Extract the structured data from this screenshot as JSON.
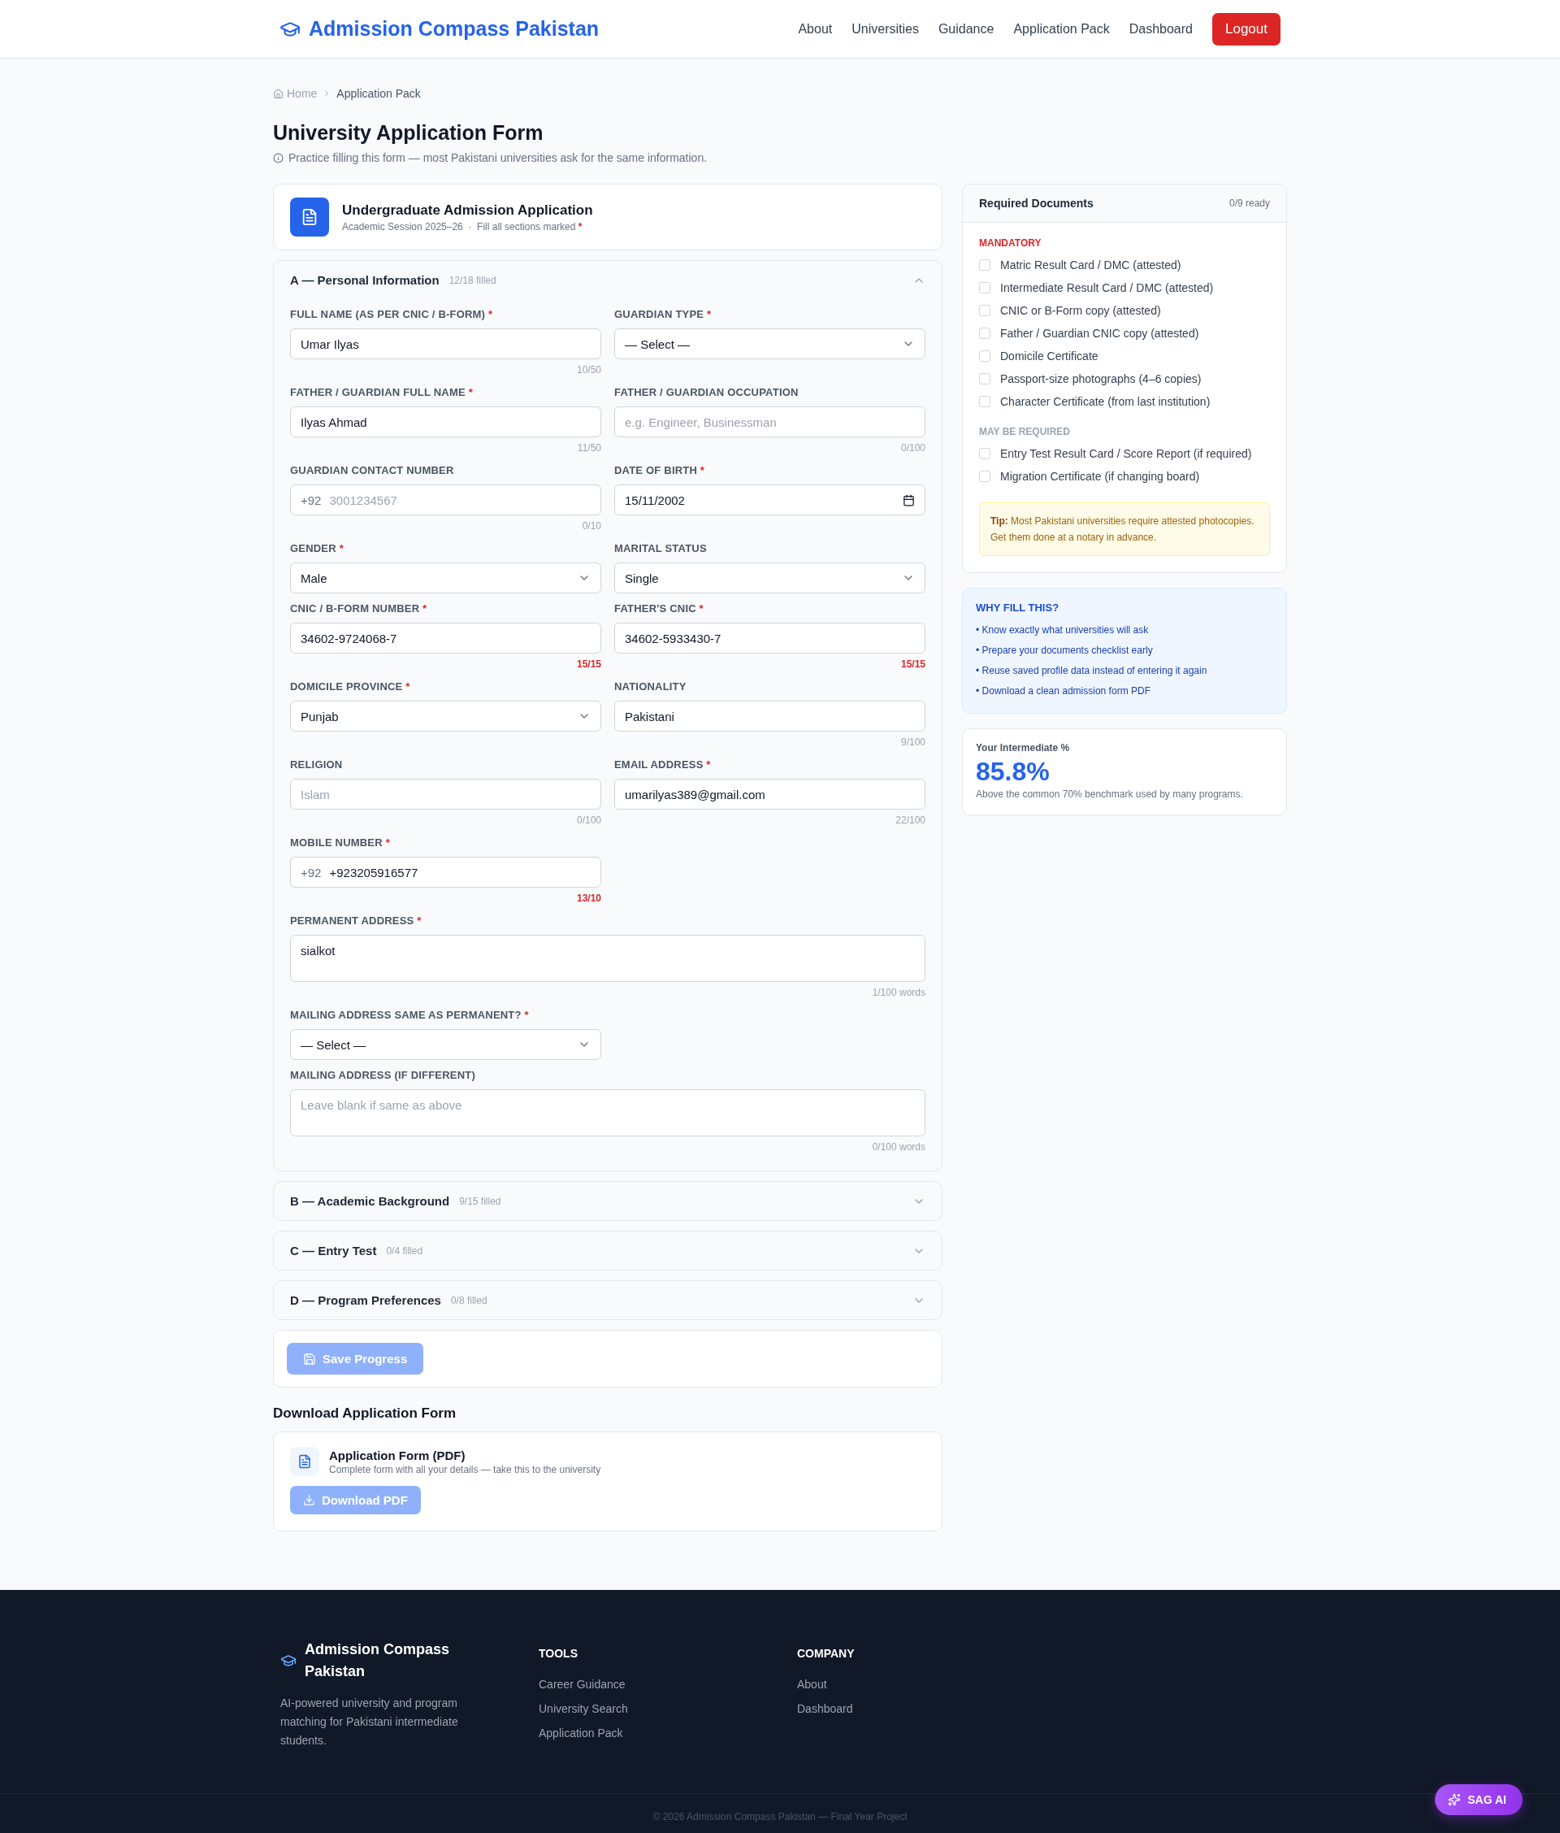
{
  "header": {
    "brand": "Admission Compass Pakistan",
    "nav": [
      {
        "label": "About"
      },
      {
        "label": "Universities"
      },
      {
        "label": "Guidance"
      },
      {
        "label": "Application Pack"
      },
      {
        "label": "Dashboard"
      }
    ],
    "logout": "Logout"
  },
  "breadcrumb": {
    "home": "Home",
    "current": "Application Pack"
  },
  "page": {
    "title": "University Application Form",
    "subtitle": "Practice filling this form — most Pakistani universities ask for the same information."
  },
  "form_header": {
    "title": "Undergraduate Admission Application",
    "subtitle": "Academic Session 2025–26  ·  Fill all sections marked",
    "required_mark": "*"
  },
  "sections": [
    {
      "label": "A — Personal Information",
      "progress": "12/18 filled",
      "expanded": true,
      "fields": [
        {
          "kind": "text",
          "label": "FULL NAME (AS PER CNIC / B-FORM)",
          "required_mark": "*",
          "value": "Umar Ilyas",
          "counter": "10/50",
          "over": false
        },
        {
          "kind": "select",
          "label": "GUARDIAN TYPE",
          "required_mark": "*",
          "value": "— Select —"
        },
        {
          "kind": "text",
          "label": "FATHER / GUARDIAN FULL NAME",
          "required_mark": "*",
          "value": "Ilyas Ahmad",
          "counter": "11/50",
          "over": false
        },
        {
          "kind": "text",
          "label": "FATHER / GUARDIAN OCCUPATION",
          "placeholder": "e.g. Engineer, Businessman",
          "counter": "0/100",
          "over": false
        },
        {
          "kind": "phone",
          "label": "GUARDIAN CONTACT NUMBER",
          "prefix": "+92",
          "placeholder": "3001234567",
          "counter": "0/10",
          "over": false
        },
        {
          "kind": "date",
          "label": "DATE OF BIRTH",
          "required_mark": "*",
          "value": "15/11/2002"
        },
        {
          "kind": "select",
          "label": "GENDER",
          "required_mark": "*",
          "value": "Male"
        },
        {
          "kind": "select",
          "label": "MARITAL STATUS",
          "value": "Single"
        },
        {
          "kind": "text",
          "label": "CNIC / B-FORM NUMBER",
          "required_mark": "*",
          "value": "34602-9724068-7",
          "counter": "15/15",
          "over": true
        },
        {
          "kind": "text",
          "label": "FATHER'S CNIC",
          "required_mark": "*",
          "value": "34602-5933430-7",
          "counter": "15/15",
          "over": true
        },
        {
          "kind": "select",
          "label": "DOMICILE PROVINCE",
          "required_mark": "*",
          "value": "Punjab"
        },
        {
          "kind": "text",
          "label": "NATIONALITY",
          "value": "Pakistani",
          "counter": "9/100",
          "over": false
        },
        {
          "kind": "text",
          "label": "RELIGION",
          "placeholder": "Islam",
          "counter": "0/100",
          "over": false
        },
        {
          "kind": "text",
          "label": "EMAIL ADDRESS",
          "required_mark": "*",
          "value": "umarilyas389@gmail.com",
          "counter": "22/100",
          "over": false
        },
        {
          "kind": "phone",
          "label": "MOBILE NUMBER",
          "required_mark": "*",
          "prefix": "+92",
          "value": "+923205916577",
          "counter": "13/10",
          "over": true
        },
        {
          "kind": "textarea",
          "label": "PERMANENT ADDRESS",
          "required_mark": "*",
          "value": "sialkot",
          "counter": "1/100 words",
          "over": false
        },
        {
          "kind": "select",
          "label": "MAILING ADDRESS SAME AS PERMANENT?",
          "required_mark": "*",
          "value": "— Select —"
        },
        {
          "kind": "textarea",
          "label": "MAILING ADDRESS (IF DIFFERENT)",
          "placeholder": "Leave blank if same as above",
          "counter": "0/100 words",
          "over": false
        }
      ]
    },
    {
      "label": "B — Academic Background",
      "progress": "9/15 filled",
      "expanded": false
    },
    {
      "label": "C — Entry Test",
      "progress": "0/4 filled",
      "expanded": false
    },
    {
      "label": "D — Program Preferences",
      "progress": "0/8 filled",
      "expanded": false
    }
  ],
  "save_button": {
    "label": "Save Progress",
    "disabled": true
  },
  "download": {
    "heading": "Download Application Form",
    "title": "Application Form (PDF)",
    "description": "Complete form with all your details — take this to the university",
    "button": {
      "label": "Download PDF",
      "disabled": true
    }
  },
  "documents": {
    "title": "Required Documents",
    "status": "0/9 ready",
    "groups": [
      {
        "label": "MANDATORY",
        "kind": "mandatory",
        "items": [
          {
            "label": "Matric Result Card / DMC (attested)",
            "checked": false
          },
          {
            "label": "Intermediate Result Card / DMC (attested)",
            "checked": false
          },
          {
            "label": "CNIC or B-Form copy (attested)",
            "checked": false
          },
          {
            "label": "Father / Guardian CNIC copy (attested)",
            "checked": false
          },
          {
            "label": "Domicile Certificate",
            "checked": false
          },
          {
            "label": "Passport-size photographs (4–6 copies)",
            "checked": false
          },
          {
            "label": "Character Certificate (from last institution)",
            "checked": false
          }
        ]
      },
      {
        "label": "MAY BE REQUIRED",
        "kind": "optional",
        "items": [
          {
            "label": "Entry Test Result Card / Score Report (if required)",
            "checked": false
          },
          {
            "label": "Migration Certificate (if changing board)",
            "checked": false
          }
        ]
      }
    ],
    "tip": "**Tip:** Most Pakistani universities require attested photocopies. Get them done at a notary in advance."
  },
  "why_fill": {
    "title": "WHY FILL THIS?",
    "items": [
      "• Know exactly what universities will ask",
      "• Prepare your documents checklist early",
      "• Reuse saved profile data instead of entering it again",
      "• Download a clean admission form PDF"
    ]
  },
  "intermediate": {
    "label": "Your Intermediate %",
    "value": "85.8%",
    "note": "Above the common 70% benchmark used by many programs."
  },
  "footer": {
    "brand": "Admission Compass Pakistan",
    "description": "AI-powered university and program matching for Pakistani intermediate students.",
    "columns": [
      {
        "title": "TOOLS",
        "links": [
          "Career Guidance",
          "University Search",
          "Application Pack"
        ]
      },
      {
        "title": "COMPANY",
        "links": [
          "About",
          "Dashboard"
        ]
      }
    ],
    "copyright": "© 2026 Admission Compass Pakistan — Final Year Project"
  },
  "chat_button": {
    "label": "SAG AI"
  }
}
